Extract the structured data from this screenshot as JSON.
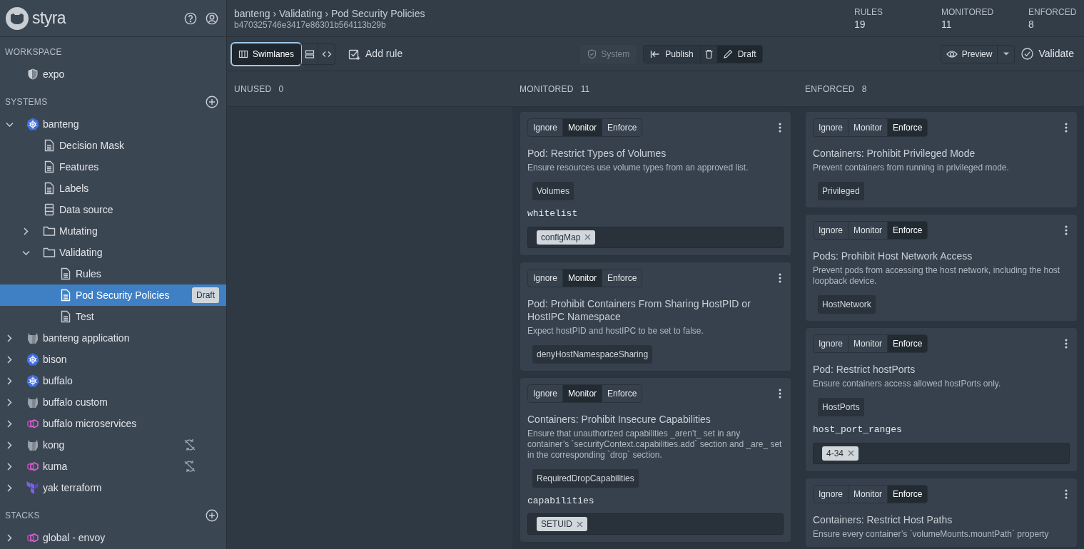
{
  "brand": "styra",
  "sidebar": {
    "sections": [
      {
        "title": "WORKSPACE",
        "items": [
          {
            "label": "expo",
            "kind": "shield",
            "selected": false
          }
        ]
      },
      {
        "title": "SYSTEMS",
        "add": true,
        "items": [
          {
            "label": "banteng",
            "kind": "k8s",
            "expanded": true,
            "selected": false,
            "children": [
              {
                "label": "Decision Mask",
                "kind": "file",
                "selected": false
              },
              {
                "label": "Features",
                "kind": "file",
                "selected": false
              },
              {
                "label": "Labels",
                "kind": "file",
                "selected": false
              },
              {
                "label": "Data source",
                "kind": "db",
                "selected": false
              },
              {
                "label": "Mutating",
                "kind": "folder",
                "expanded": false,
                "selected": false
              },
              {
                "label": "Validating",
                "kind": "folder",
                "expanded": true,
                "selected": false,
                "children": [
                  {
                    "label": "Rules",
                    "kind": "file",
                    "selected": false
                  },
                  {
                    "label": "Pod Security Policies",
                    "kind": "file",
                    "selected": true,
                    "badge": "Draft"
                  },
                  {
                    "label": "Test",
                    "kind": "file",
                    "selected": false
                  }
                ]
              }
            ]
          },
          {
            "label": "banteng application",
            "kind": "kong",
            "expanded": false,
            "selected": false
          },
          {
            "label": "bison",
            "kind": "k8s",
            "expanded": false,
            "selected": false
          },
          {
            "label": "buffalo",
            "kind": "k8s",
            "expanded": false,
            "selected": false
          },
          {
            "label": "buffalo custom",
            "kind": "kong",
            "expanded": false,
            "selected": false
          },
          {
            "label": "buffalo microservices",
            "kind": "envoy",
            "expanded": false,
            "selected": false
          },
          {
            "label": "kong",
            "kind": "kong",
            "expanded": false,
            "selected": false,
            "sync_disabled": true
          },
          {
            "label": "kuma",
            "kind": "envoy",
            "expanded": false,
            "selected": false,
            "sync_disabled": true
          },
          {
            "label": "yak terraform",
            "kind": "terraform",
            "expanded": false,
            "selected": false
          }
        ]
      },
      {
        "title": "STACKS",
        "add": true,
        "items": [
          {
            "label": "global - envoy",
            "kind": "envoy",
            "expanded": false,
            "selected": false
          }
        ]
      }
    ]
  },
  "header": {
    "breadcrumb": "banteng › Validating › Pod Security Policies",
    "id": "b470325746e3417e86301b564113b29b",
    "stats": [
      {
        "label": "RULES",
        "value": "19"
      },
      {
        "label": "MONITORED",
        "value": "11"
      },
      {
        "label": "ENFORCED",
        "value": "8"
      }
    ]
  },
  "toolbar": {
    "views": [
      {
        "kind": "swimlanes",
        "label": "Swimlanes",
        "selected": true
      },
      {
        "kind": "list",
        "selected": false
      },
      {
        "kind": "code",
        "selected": false
      }
    ],
    "add_rule": "Add rule",
    "system": {
      "label": "System",
      "disabled": true
    },
    "publish": "Publish",
    "draft": "Draft",
    "preview": "Preview",
    "validate": "Validate"
  },
  "lanes": [
    {
      "title": "UNUSED",
      "count": "0"
    },
    {
      "title": "MONITORED",
      "count": "11",
      "cards": [
        {
          "modes": [
            {
              "label": "Ignore",
              "selected": false
            },
            {
              "label": "Monitor",
              "selected": true
            },
            {
              "label": "Enforce",
              "selected": false
            }
          ],
          "title": "Pod: Restrict Types of Volumes",
          "description": "Ensure resources use volume types from an approved list.",
          "tag": "Volumes",
          "param": {
            "name": "whitelist",
            "values": [
              "configMap"
            ]
          }
        },
        {
          "modes": [
            {
              "label": "Ignore",
              "selected": false
            },
            {
              "label": "Monitor",
              "selected": true
            },
            {
              "label": "Enforce",
              "selected": false
            }
          ],
          "title": "Pod: Prohibit Containers From Sharing HostPID or HostIPC Namespace",
          "description": "Expect hostPID and hostIPC to be set to false.",
          "tag": "denyHostNamespaceSharing"
        },
        {
          "modes": [
            {
              "label": "Ignore",
              "selected": false
            },
            {
              "label": "Monitor",
              "selected": true
            },
            {
              "label": "Enforce",
              "selected": false
            }
          ],
          "title": "Containers: Prohibit Insecure Capabilities",
          "description": "Ensure that unauthorized capabilities _aren’t_ set in any container’s `securityContext.capabilities.add` section and _are_ set in the corresponding `drop` section.",
          "tag": "RequiredDropCapabilities",
          "param": {
            "name": "capabilities",
            "values": [
              "SETUID"
            ]
          }
        }
      ]
    },
    {
      "title": "ENFORCED",
      "count": "8",
      "cards": [
        {
          "modes": [
            {
              "label": "Ignore",
              "selected": false
            },
            {
              "label": "Monitor",
              "selected": false
            },
            {
              "label": "Enforce",
              "selected": true
            }
          ],
          "title": "Containers: Prohibit Privileged Mode",
          "description": "Prevent containers from running in privileged mode.",
          "tag": "Privileged"
        },
        {
          "modes": [
            {
              "label": "Ignore",
              "selected": false
            },
            {
              "label": "Monitor",
              "selected": false
            },
            {
              "label": "Enforce",
              "selected": true
            }
          ],
          "title": "Pods: Prohibit Host Network Access",
          "description": "Prevent pods from accessing the host network, including the host loopback device.",
          "tag": "HostNetwork"
        },
        {
          "modes": [
            {
              "label": "Ignore",
              "selected": false
            },
            {
              "label": "Monitor",
              "selected": false
            },
            {
              "label": "Enforce",
              "selected": true
            }
          ],
          "title": "Pod: Restrict hostPorts",
          "description": "Ensure containers access allowed hostPorts only.",
          "tag": "HostPorts",
          "param": {
            "name": "host_port_ranges",
            "values": [
              "4-34"
            ]
          }
        },
        {
          "modes": [
            {
              "label": "Ignore",
              "selected": false
            },
            {
              "label": "Monitor",
              "selected": false
            },
            {
              "label": "Enforce",
              "selected": true
            }
          ],
          "title": "Containers: Restrict Host Paths",
          "description": "Ensure every container’s `volumeMounts.mountPath` property"
        }
      ]
    }
  ]
}
